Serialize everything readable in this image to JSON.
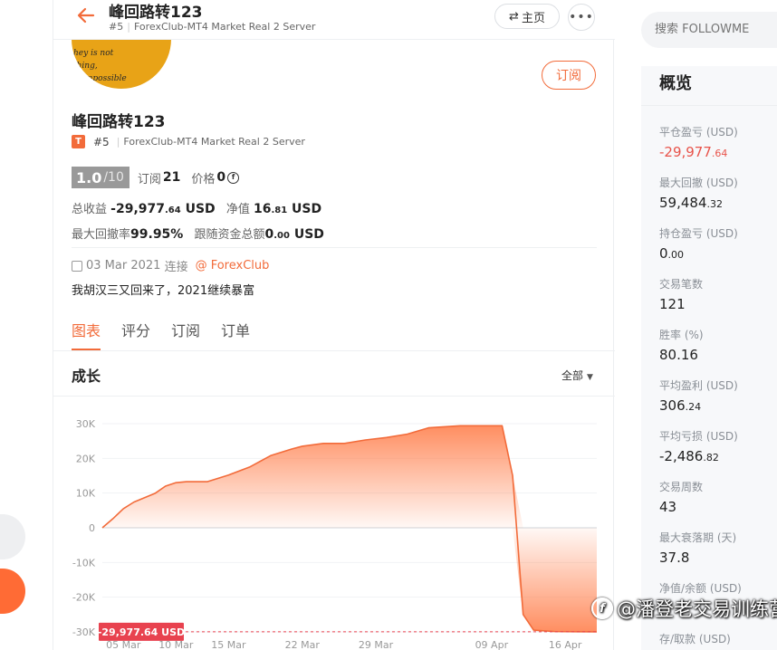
{
  "header": {
    "title": "峰回路转123",
    "rank": "#5",
    "server": "ForexClub-MT4 Market Real 2 Server",
    "home_label": "主页",
    "home_icon": "swap-icon",
    "more_label": "•••"
  },
  "profile": {
    "avatar_text": [
      "hey is not",
      "thing,",
      "impossible"
    ],
    "subscribe_label": "订阅",
    "name": "峰回路转123",
    "badge": "T",
    "rank": "#5",
    "server": "ForexClub-MT4 Market Real 2 Server",
    "score": "1.0",
    "score_max": "/10",
    "subscribe_count_label": "订阅",
    "subscribe_count": "21",
    "price_label": "价格",
    "price_value": "0",
    "price_icon": "ⓕ",
    "total_profit_label": "总收益",
    "total_profit_int": "-29,977",
    "total_profit_dec": ".64",
    "total_profit_unit": "USD",
    "net_label": "净值",
    "net_int": "16",
    "net_dec": ".81",
    "net_unit": "USD",
    "max_dd_label": "最大回撤率",
    "max_dd_value": "99.95%",
    "follow_funds_label": "跟随资金总额",
    "follow_funds_int": "0",
    "follow_funds_dec": ".00",
    "follow_funds_unit": "USD",
    "date": "03 Mar 2021",
    "connect_label": "连接",
    "broker_link": "@ ForexClub",
    "description": "我胡汉三又回来了，2021继续暴富"
  },
  "tabs": [
    {
      "label": "图表",
      "active": true
    },
    {
      "label": "评分",
      "active": false
    },
    {
      "label": "订阅",
      "active": false
    },
    {
      "label": "订单",
      "active": false
    }
  ],
  "growth": {
    "title": "成长",
    "range_label": "全部"
  },
  "chart_data": {
    "type": "area",
    "title": "",
    "xlabel": "",
    "ylabel": "",
    "ylim": [
      -30000,
      30000
    ],
    "yticks": [
      30000,
      20000,
      10000,
      0,
      -10000,
      -20000,
      -30000
    ],
    "ytick_labels": [
      "30K",
      "20K",
      "10K",
      "0",
      "-10K",
      "-20K",
      "-30K"
    ],
    "xtick_labels": [
      "05 Mar",
      "10 Mar",
      "15 Mar",
      "22 Mar",
      "29 Mar",
      "09 Apr",
      "16 Apr"
    ],
    "x_date_start": "2021-03-03",
    "x_date_end": "2021-04-19",
    "x": [
      "2021-03-03",
      "2021-03-04",
      "2021-03-05",
      "2021-03-06",
      "2021-03-08",
      "2021-03-09",
      "2021-03-10",
      "2021-03-11",
      "2021-03-13",
      "2021-03-15",
      "2021-03-17",
      "2021-03-19",
      "2021-03-21",
      "2021-03-22",
      "2021-03-24",
      "2021-03-26",
      "2021-03-28",
      "2021-03-30",
      "2021-04-01",
      "2021-04-03",
      "2021-04-06",
      "2021-04-09",
      "2021-04-10",
      "2021-04-11",
      "2021-04-12",
      "2021-04-13",
      "2021-04-15",
      "2021-04-17",
      "2021-04-19"
    ],
    "series": [
      {
        "values": [
          0,
          2600,
          5500,
          7400,
          9900,
          12000,
          13000,
          13300,
          13300,
          15200,
          17500,
          20800,
          22700,
          23500,
          24300,
          24300,
          25300,
          26000,
          27000,
          28800,
          29400,
          29400,
          29400,
          15000,
          -25000,
          -29500,
          -29900,
          -29950,
          -29977.64
        ]
      }
    ],
    "current_value_label": "-29,977.64 USD",
    "line_color": "#f26b3a",
    "fill_color": "#ff7a45"
  },
  "overview": {
    "search_placeholder": "搜索 FOLLOWME",
    "title": "概览",
    "items": [
      {
        "label": "平仓盈亏 (USD)",
        "int": "-29,977",
        "dec": ".64",
        "negative": true
      },
      {
        "label": "最大回撤 (USD)",
        "int": "59,484",
        "dec": ".32",
        "negative": false
      },
      {
        "label": "持仓盈亏 (USD)",
        "int": "0",
        "dec": ".00",
        "negative": false
      },
      {
        "label": "交易笔数",
        "int": "121",
        "dec": "",
        "negative": false
      },
      {
        "label": "胜率 (%)",
        "int": "80.16",
        "dec": "",
        "negative": false
      },
      {
        "label": "平均盈利 (USD)",
        "int": "306",
        "dec": ".24",
        "negative": false
      },
      {
        "label": "平均亏损 (USD)",
        "int": "-2,486",
        "dec": ".82",
        "negative": false
      },
      {
        "label": "交易周数",
        "int": "43",
        "dec": "",
        "negative": false
      },
      {
        "label": "最大衰落期 (天)",
        "int": "37.8",
        "dec": "",
        "negative": false
      },
      {
        "label": "净值/余额 (USD)",
        "int": "",
        "dec": "",
        "negative": false
      },
      {
        "label": "存/取款 (USD)",
        "int": "",
        "dec": "",
        "negative": false
      }
    ]
  },
  "watermark": {
    "logo": "f",
    "text": "@潘登老交易训练营"
  },
  "colors": {
    "accent": "#f26b3a",
    "negative": "#e8534a",
    "badge_bg": "#e8424f"
  }
}
